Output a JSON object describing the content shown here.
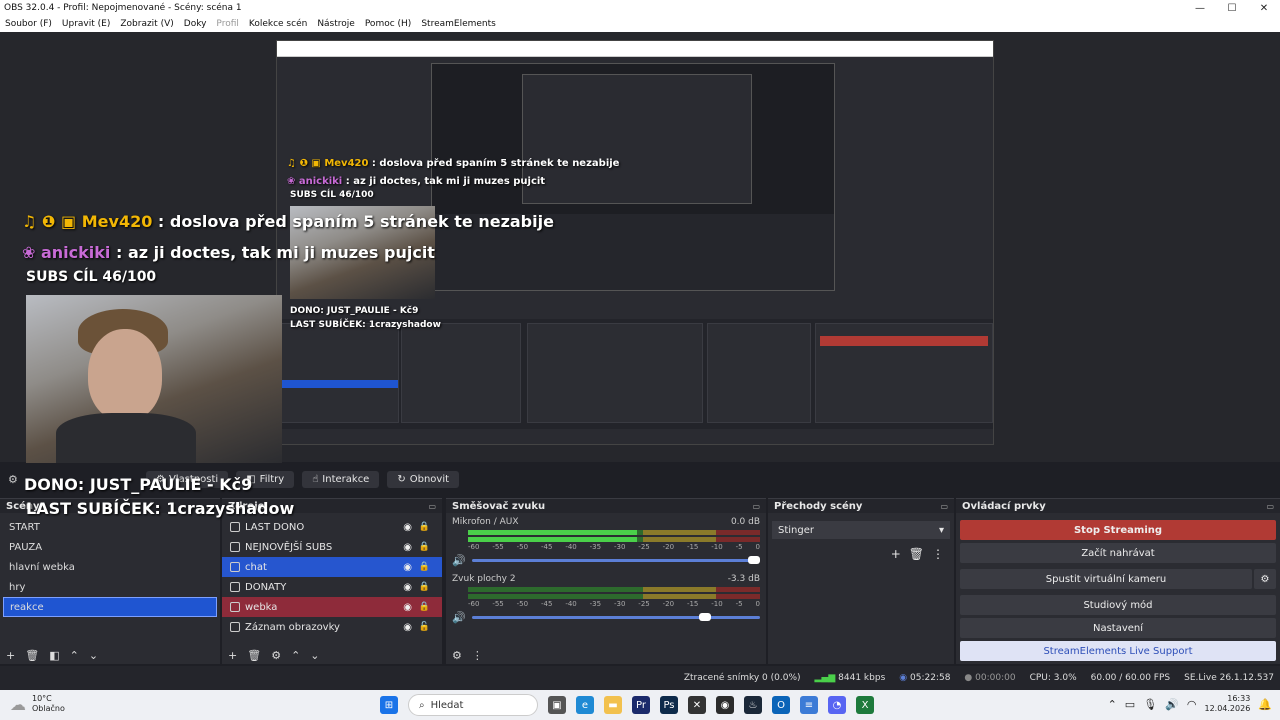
{
  "window": {
    "title": "OBS 32.0.4 - Profil: Nepojmenované - Scény: scéna 1",
    "controls": [
      "—",
      "☐",
      "✕"
    ]
  },
  "menu": [
    "Soubor (F)",
    "Upravit (E)",
    "Zobrazit (V)",
    "Doky",
    "Profil",
    "Kolekce scén",
    "Nástroje",
    "Pomoc (H)",
    "StreamElements"
  ],
  "overlay": {
    "chat1_user": "Mev420",
    "chat1_msg": ": doslova před spaním 5 stránek te nezabije",
    "chat2_user": "anickiki",
    "chat2_msg": ": az ji doctes, tak mi ji muzes pujcit",
    "subs_goal": "SUBS CÍL 46/100",
    "dono": "DONO: JUST_PAULIE - Kč9",
    "last_sub": "LAST SUBÍČEK: 1crazyshadow"
  },
  "source_toolbar": {
    "properties": "Vlastnosti",
    "filters": "Filtry",
    "interact": "Interakce",
    "refresh": "Obnovit"
  },
  "scenes": {
    "title": "Scény",
    "items": [
      "START",
      "PAUZA",
      "hlavní webka",
      "hry",
      "reakce"
    ],
    "selected": "reakce"
  },
  "sources": {
    "title": "Zdroje",
    "items": [
      "LAST DONO",
      "NEJNOVĚJŠÍ SUBS",
      "chat",
      "DONATY",
      "webka",
      "Záznam obrazovky"
    ]
  },
  "mixer": {
    "title": "Směšovač zvuku",
    "ticks": [
      "-60",
      "-55",
      "-50",
      "-45",
      "-40",
      "-35",
      "-30",
      "-25",
      "-20",
      "-15",
      "-10",
      "-5",
      "0"
    ],
    "channels": [
      {
        "name": "Mikrofon / AUX",
        "db": "0.0 dB",
        "level": 0.58,
        "volume": 1.0
      },
      {
        "name": "Zvuk plochy 2",
        "db": "-3.3 dB",
        "level": 0.0,
        "volume": 0.83
      }
    ]
  },
  "transitions": {
    "title": "Přechody scény",
    "selected": "Stinger"
  },
  "controls": {
    "title": "Ovládací prvky",
    "stop_streaming": "Stop Streaming",
    "start_recording": "Začít nahrávat",
    "virtual_camera": "Spustit virtuální kameru",
    "studio_mode": "Studiový mód",
    "settings": "Nastavení",
    "support": "StreamElements Live Support"
  },
  "status": {
    "dropped": "Ztracené snímky 0 (0.0%)",
    "bitrate": "8441 kbps",
    "stream_time": "05:22:58",
    "rec_time": "00:00:00",
    "cpu": "CPU: 3.0%",
    "fps": "60.00 / 60.00 FPS",
    "version": "SE.Live 26.1.12.537"
  },
  "taskbar": {
    "temp": "10°C",
    "weather": "Oblačno",
    "search": "Hledat",
    "time": "16:33",
    "date": "12.04.2026"
  },
  "colors": {
    "accent": "#1f55d1",
    "stop": "#b13a34",
    "webka": "#8e2b3a",
    "donation": "#f2b705",
    "user2": "#c86bd6"
  }
}
